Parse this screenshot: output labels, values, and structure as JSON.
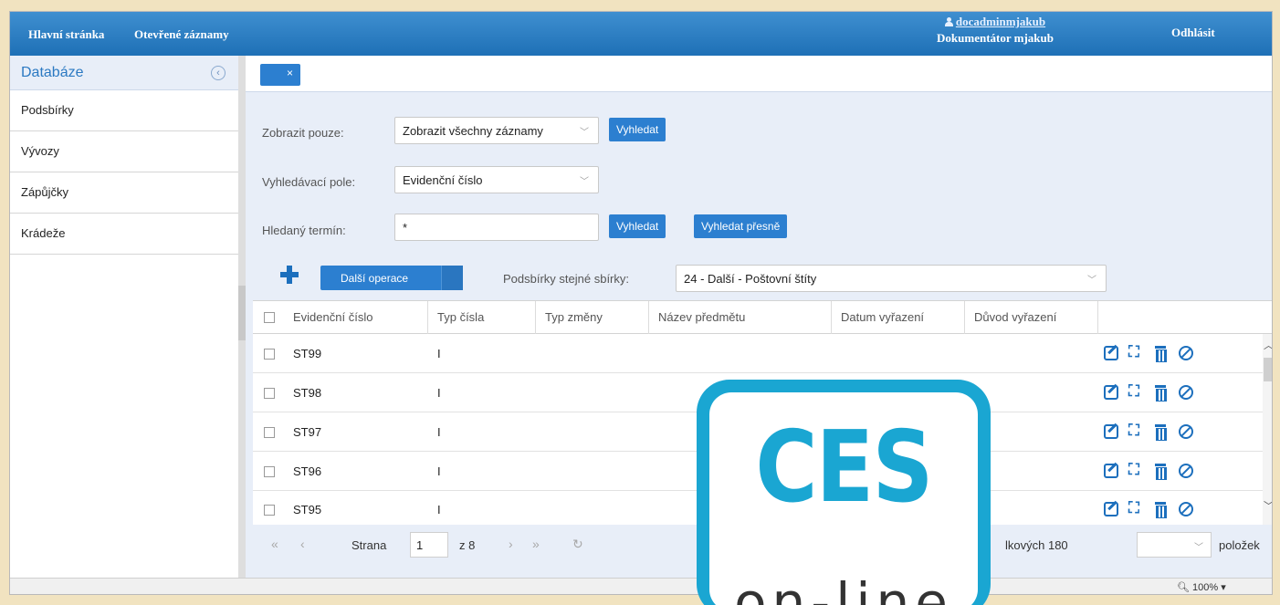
{
  "topbar": {
    "nav": [
      "Hlavní stránka",
      "Otevřené záznamy"
    ],
    "user_login": "docadminmjakub",
    "user_role": "Dokumentátor mjakub",
    "logout": "Odhlásit"
  },
  "sidebar": {
    "title": "Databáze",
    "items": [
      {
        "label": "Podsbírky"
      },
      {
        "label": "Vývozy"
      },
      {
        "label": "Zápůjčky"
      },
      {
        "label": "Krádeže"
      }
    ]
  },
  "tab": {
    "close_glyph": "×"
  },
  "filters": {
    "show_only_label": "Zobrazit pouze:",
    "show_only_value": "Zobrazit všechny záznamy",
    "search_field_label": "Vyhledávací pole:",
    "search_field_value": "Evidenční číslo",
    "search_term_label": "Hledaný termín:",
    "search_term_value": "*",
    "search_button": "Vyhledat",
    "search_exact_button": "Vyhledat přesně"
  },
  "toolbar": {
    "more_operations": "Další operace",
    "subcollections_label": "Podsbírky stejné sbírky:",
    "subcollections_value": "24 - Další - Poštovní štíty"
  },
  "table": {
    "columns": [
      "Evidenční číslo",
      "Typ čísla",
      "Typ změny",
      "Název předmětu",
      "Datum vyřazení",
      "Důvod vyřazení"
    ],
    "rows": [
      {
        "number": "ST99",
        "type": "I"
      },
      {
        "number": "ST98",
        "type": "I"
      },
      {
        "number": "ST97",
        "type": "I"
      },
      {
        "number": "ST96",
        "type": "I"
      },
      {
        "number": "ST95",
        "type": "I"
      }
    ],
    "row_actions": [
      "edit-icon",
      "expand-icon",
      "delete-icon",
      "block-icon"
    ]
  },
  "pager": {
    "page_label": "Strana",
    "page_value": "1",
    "of_total": "z 8",
    "total_text": "lkových 180",
    "items_label": "položek"
  },
  "statusbar": {
    "zoom": "100%"
  },
  "logo": {
    "big": "CES",
    "small": "on-line"
  },
  "colors": {
    "accent": "#2c7fd0",
    "topbar": "#1e70b6",
    "logo": "#1aa6d2",
    "panel": "#e8eef8"
  }
}
